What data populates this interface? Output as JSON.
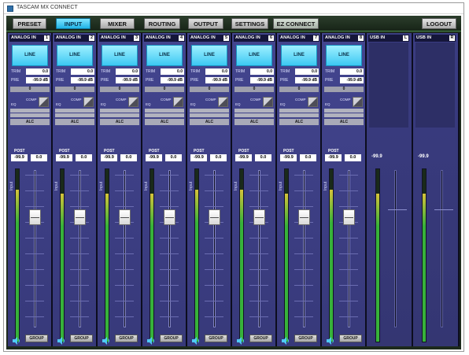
{
  "window": {
    "title": "TASCAM MX CONNECT"
  },
  "nav": {
    "tabs": [
      {
        "label": "PRESET",
        "active": false
      },
      {
        "label": "INPUT",
        "active": true
      },
      {
        "label": "MIXER",
        "active": false
      },
      {
        "label": "ROUTING",
        "active": false
      },
      {
        "label": "OUTPUT",
        "active": false
      },
      {
        "label": "SETTINGS",
        "active": false
      },
      {
        "label": "EZ CONNECT",
        "active": false
      }
    ],
    "logout_label": "LOGOUT"
  },
  "labels": {
    "line": "LINE",
    "trim": "TRIM",
    "pre": "PRE",
    "comp": "COMP",
    "eq": "EQ",
    "alc": "ALC",
    "post": "POST",
    "input": "Input",
    "group": "GROUP",
    "zero": "0"
  },
  "channels": [
    {
      "name": "ANALOG IN",
      "number": "1",
      "trim": "0.0",
      "pre": "-99.9 dB",
      "post": "-99.9",
      "fader": "0.0",
      "meter_level": 0.88,
      "fader_position": 0.3
    },
    {
      "name": "ANALOG IN",
      "number": "2",
      "trim": "0.0",
      "pre": "-99.9 dB",
      "post": "-99.9",
      "fader": "0.0",
      "meter_level": 0.86,
      "fader_position": 0.3
    },
    {
      "name": "ANALOG IN",
      "number": "3",
      "trim": "0.0",
      "pre": "-99.9 dB",
      "post": "-99.9",
      "fader": "0.0",
      "meter_level": 0.86,
      "fader_position": 0.3
    },
    {
      "name": "ANALOG IN",
      "number": "4",
      "trim": "0.0",
      "pre": "-99.9 dB",
      "post": "-99.9",
      "fader": "0.0",
      "meter_level": 0.86,
      "fader_position": 0.3
    },
    {
      "name": "ANALOG IN",
      "number": "5",
      "trim": "0.0",
      "pre": "-99.9 dB",
      "post": "-99.9",
      "fader": "0.0",
      "meter_level": 0.88,
      "fader_position": 0.3
    },
    {
      "name": "ANALOG IN",
      "number": "6",
      "trim": "0.0",
      "pre": "-99.9 dB",
      "post": "-99.9",
      "fader": "0.0",
      "meter_level": 0.88,
      "fader_position": 0.3
    },
    {
      "name": "ANALOG IN",
      "number": "7",
      "trim": "0.0",
      "pre": "-99.9 dB",
      "post": "-99.9",
      "fader": "0.0",
      "meter_level": 0.86,
      "fader_position": 0.3
    },
    {
      "name": "ANALOG IN",
      "number": "8",
      "trim": "0.0",
      "pre": "-99.9 dB",
      "post": "-99.9",
      "fader": "0.0",
      "meter_level": 0.88,
      "fader_position": 0.3
    }
  ],
  "usb": [
    {
      "name": "USB IN",
      "side": "L",
      "value": "-99.9",
      "meter_level": 0.86
    },
    {
      "name": "USB IN",
      "side": "R",
      "value": "-99.9",
      "meter_level": 0.86
    }
  ],
  "colors": {
    "accent": "#3cc8f3",
    "meter_green": "#37b23a",
    "meter_yellow": "#d6c33a",
    "strip_bg": "#43458f"
  },
  "icons": {
    "monitor": "speaker-icon",
    "app": "tascam-app-icon"
  }
}
